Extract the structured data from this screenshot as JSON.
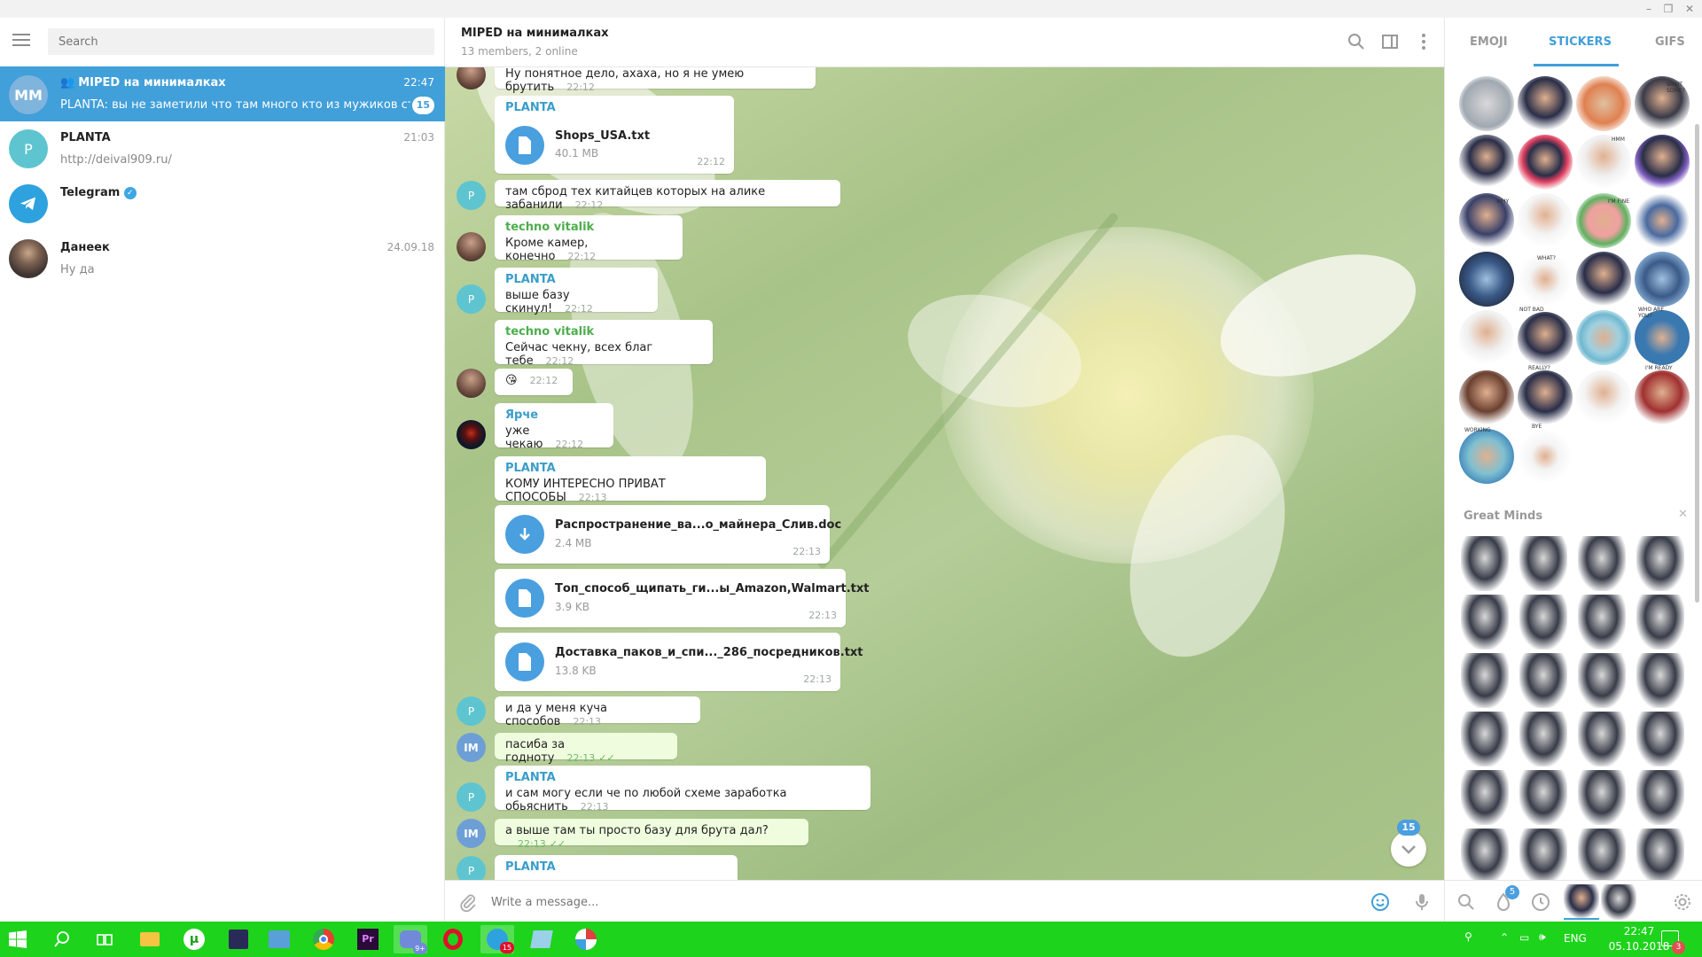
{
  "window": {
    "minimize": "–",
    "maximize": "❐",
    "close": "✕"
  },
  "search": {
    "placeholder": "Search"
  },
  "dialogs": [
    {
      "avatar": "MM",
      "name": "MIPED на минималках",
      "time": "22:47",
      "preview": "PLANTA: вы не заметили что там много кто из мужиков страп...",
      "badge": "15",
      "color": "#419fd9"
    },
    {
      "avatar": "P",
      "name": "PLANTA",
      "time": "21:03",
      "preview": "http://deival909.ru/",
      "color": "#5ec5d0"
    },
    {
      "avatar": "",
      "name": "Telegram",
      "time": "",
      "preview": "",
      "color": "#2ea2de"
    },
    {
      "avatar": "",
      "name": "Данеек",
      "time": "24.09.18",
      "preview": "Ну да",
      "color": "#6a5a4e"
    }
  ],
  "header": {
    "title": "MIPED на минималках",
    "subtitle": "13 members, 2 online"
  },
  "messages": {
    "m0": {
      "text": "Ну понятное дело, ахаха, но я не умею брутить",
      "time": "22:12"
    },
    "m1": {
      "sender": "PLANTA",
      "file": "Shops_USA.txt",
      "size": "40.1 MB",
      "time": "22:12"
    },
    "m2": {
      "text": "там сброд тех китайцев которых на алике забанили",
      "time": "22:12"
    },
    "m3": {
      "sender": "techno vitalik",
      "text": "Кроме камер, конечно",
      "time": "22:12"
    },
    "m4": {
      "sender": "PLANTA",
      "text": "выше базу скинул!",
      "time": "22:12"
    },
    "m5": {
      "sender": "techno vitalik",
      "text": "Сейчас чекну, всех благ тебе",
      "time": "22:12"
    },
    "m6": {
      "text": "😘",
      "time": "22:12"
    },
    "m7": {
      "sender": "Ярче",
      "text": "уже чекаю",
      "time": "22:12"
    },
    "m8": {
      "sender": "PLANTA",
      "text": "КОМУ ИНТЕРЕСНО ПРИВАТ СПОСОБЫ",
      "time": "22:13"
    },
    "m9": {
      "file": "Распространение_ва...о_майнера_Слив.doc",
      "size": "2.4 MB",
      "time": "22:13"
    },
    "m10": {
      "file": "Топ_способ_щипать_ги...ы_Amazon,Walmart.txt",
      "size": "3.9 KB",
      "time": "22:13"
    },
    "m11": {
      "file": "Доставка_паков_и_спи..._286_посредников.txt",
      "size": "13.8 KB",
      "time": "22:13"
    },
    "m12": {
      "text": "и да у меня куча способов",
      "time": "22:13"
    },
    "m13": {
      "text": "пасиба за годноту",
      "time": "22:13"
    },
    "m14": {
      "sender": "PLANTA",
      "text": "и сам могу если че по любой схеме заработка обьяснить",
      "time": "22:13"
    },
    "m15": {
      "text": "а выше там ты просто базу для брута дал?",
      "time": "22:13"
    },
    "m16": {
      "sender": "PLANTA"
    }
  },
  "avatars": {
    "p": "P",
    "im": "IM"
  },
  "colors": {
    "planta": "#3a9dc9",
    "techno": "#4cae4c",
    "yarche": "#3a9dc9",
    "accent": "#419fd9"
  },
  "scroll_badge": "15",
  "compose": {
    "placeholder": "Write a message..."
  },
  "panel": {
    "tabs": [
      "EMOJI",
      "STICKERS",
      "GIFS"
    ],
    "sticker_texts": [
      "WANT SOME?",
      "HMM",
      "WHY",
      "I'M FINE",
      "WHAT?",
      "NOT BAD",
      "WHO ARE YOU?",
      "REALLY?",
      "I'M READY",
      "WORKING",
      "BYE"
    ],
    "pack_title": "Great Minds",
    "pack_close": "✕",
    "footer_badge": "5"
  },
  "taskbar": {
    "lang": "ENG",
    "time": "22:47",
    "date": "05.10.2018",
    "notif": "3",
    "tg_badge": "15",
    "discord_badge": "9+"
  }
}
